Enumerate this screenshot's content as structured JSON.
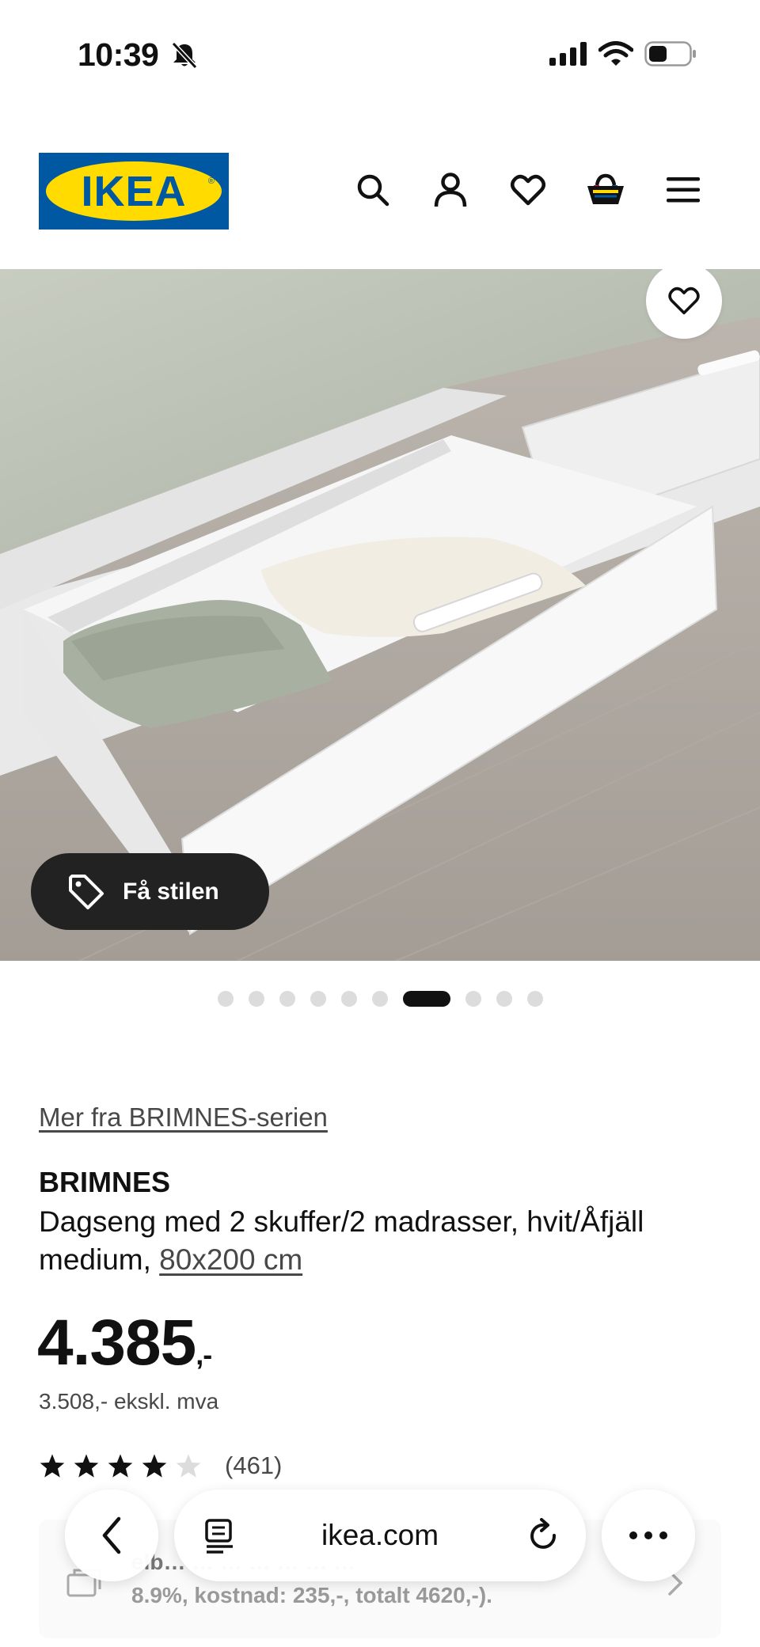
{
  "status_bar": {
    "time": "10:39",
    "icons": [
      "bell-slash-icon",
      "signal-icon",
      "wifi-icon",
      "battery-icon"
    ]
  },
  "header": {
    "logo_text": "IKEA",
    "logo_colors": {
      "blue": "#0058a3",
      "yellow": "#ffdb00"
    },
    "icons": [
      "search-icon",
      "account-icon",
      "wishlist-heart-icon",
      "shopping-bag-icon",
      "menu-icon"
    ]
  },
  "gallery": {
    "style_button_label": "Få stilen",
    "total_images": 10,
    "active_index": 7,
    "favorite_icon": "heart-icon"
  },
  "product": {
    "series_link": "Mer fra BRIMNES-serien",
    "brand": "BRIMNES",
    "description": "Dagseng med 2 skuffer/2 madrasser, hvit/Åfjäll medium,",
    "size_link": "80x200 cm",
    "price_main": "4.385",
    "price_suffix": ",-",
    "price_excl_vat": "3.508,- ekskl. mva",
    "rating_stars": 4,
    "rating_max": 5,
    "review_count": "(461)"
  },
  "finance": {
    "line1": "elb… … … … … … …",
    "line2": "8.9%, kostnad: 235,-, totalt 4620,-)."
  },
  "browser": {
    "url": "ikea.com",
    "back_icon": "chevron-left-icon",
    "reader_icon": "reader-mode-icon",
    "reload_icon": "reload-icon",
    "more_icon": "more-dots-icon"
  }
}
